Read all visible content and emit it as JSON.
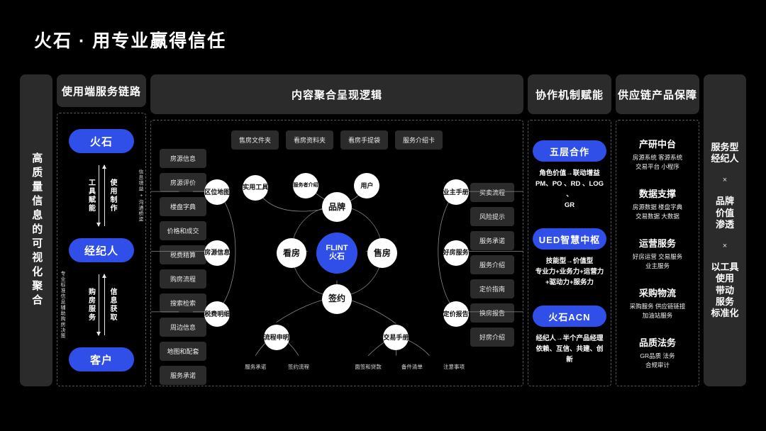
{
  "page": {
    "title": "火石  ·  用专业赢得信任"
  },
  "left_banner": {
    "text": "高质量信息的可视化聚合"
  },
  "columns": {
    "service_chain": {
      "header": "使用端服务链路",
      "pill_top": "火石",
      "pill_mid": "经纪人",
      "pill_bottom": "客户",
      "flow1": {
        "left_label": "工具赋能",
        "right_label": "使用制作",
        "side_caption": "信息增益 + 沟通桥梁"
      },
      "flow2": {
        "left_label": "购房服务",
        "right_label": "信息获取",
        "side_caption": "专业标准信息辅助购房决策"
      }
    },
    "content_logic": {
      "header": "内容聚合呈现逻辑",
      "top_tags": [
        "售房文件夹",
        "看房资料夹",
        "看房手提袋",
        "服务介绍卡"
      ],
      "left_tags": [
        "房源信息",
        "房源评价",
        "楼盘字典",
        "价格和成交",
        "税费精算",
        "购房流程",
        "搜索检索",
        "周边信息",
        "地图和配套",
        "服务承诺"
      ],
      "right_tags": [
        "买卖流程",
        "风险提示",
        "服务承诺",
        "服务介绍",
        "定价指南",
        "换房报告",
        "好房介绍"
      ],
      "center_node": {
        "line1": "FLINT",
        "line2": "火石"
      },
      "main_nodes": {
        "top": "品牌",
        "left": "看房",
        "right": "售房",
        "bottom": "签约"
      },
      "top_satellites": [
        "实用工具",
        "服务者介绍",
        "用户"
      ],
      "left_satellites": [
        "区位地图",
        "房源信息",
        "税费明细"
      ],
      "right_satellites": [
        "业主手册",
        "好房服务",
        "定价报告"
      ],
      "bottom_satellites": [
        "流程申明",
        "交易手册"
      ],
      "bottom_leaves": [
        "服务承诺",
        "签约流程",
        "面签和贷款",
        "备件清单",
        "注意事项"
      ]
    },
    "collaboration": {
      "header": "协作机制赋能",
      "blocks": [
        {
          "pill": "五层合作",
          "line1": "角色价值→联动增益",
          "line2": "PM、PO 、RD 、LOG 、",
          "line3": "GR"
        },
        {
          "pill": "UED智慧中枢",
          "line1": "技能型→价值型",
          "line2": "专业力+业务力+运营力",
          "line3": "+驱动力+服务力"
        },
        {
          "pill": "火石ACN",
          "line1": "经纪人→半个产品经理",
          "line2": "依赖、互信、共建、创新",
          "line3": ""
        }
      ]
    },
    "supply_chain": {
      "header": "供应链产品保障",
      "sections": [
        {
          "title": "产研中台",
          "line1": "房源系统  客源系统",
          "line2": "交易平台  小程序"
        },
        {
          "title": "数据支撑",
          "line1": "房源数据  楼盘字典",
          "line2": "交易数据  大数据"
        },
        {
          "title": "运营服务",
          "line1": "好房运营  交易服务",
          "line2": "业主服务"
        },
        {
          "title": "采购物流",
          "line1": "采购服务  供应链链接",
          "line2": "加油站服务"
        },
        {
          "title": "品质法务",
          "line1": "GR品质  法务",
          "line2": "合规审计"
        }
      ]
    },
    "right_banner": {
      "item1": "服务型\n经纪人",
      "sep1": "×",
      "item2": "品牌\n价值\n渗透",
      "sep2": "×",
      "item3": "以工具\n使用\n带动\n服务\n标准化"
    }
  },
  "colors": {
    "accent_blue": "#2f4fe8",
    "panel_gray": "#2b2b2b",
    "background": "#000000"
  }
}
